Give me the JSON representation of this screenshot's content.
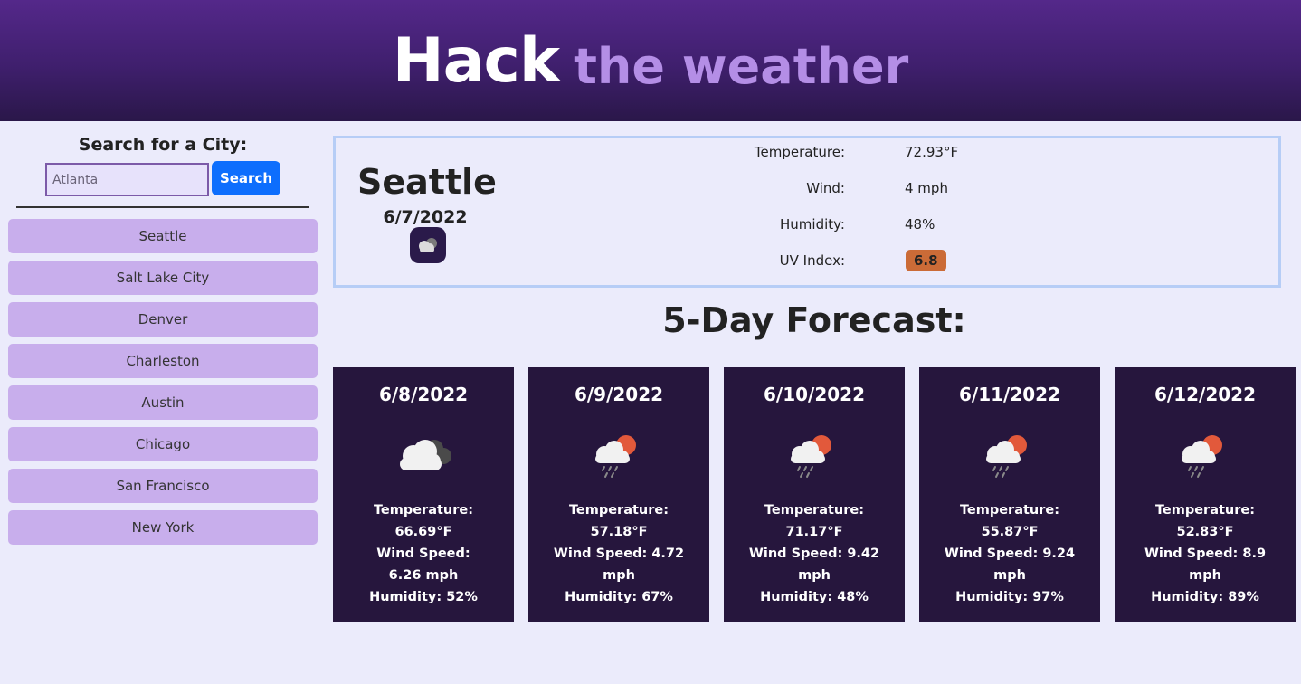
{
  "header": {
    "title_main": "Hack",
    "title_sub": "the weather"
  },
  "sidebar": {
    "search_label": "Search for a City:",
    "search_value": "Atlanta",
    "search_button": "Search",
    "cities": [
      "Seattle",
      "Salt Lake City",
      "Denver",
      "Charleston",
      "Austin",
      "Chicago",
      "San Francisco",
      "New York"
    ]
  },
  "current": {
    "city": "Seattle",
    "date": "6/7/2022",
    "icon": "cloudy-icon",
    "temperature_label": "Temperature:",
    "temperature": "72.93°F",
    "wind_label": "Wind:",
    "wind": "4 mph",
    "humidity_label": "Humidity:",
    "humidity": "48%",
    "uv_label": "UV Index:",
    "uv": "6.8",
    "uv_color": "#cb6b37"
  },
  "forecast": {
    "title": "5-Day Forecast:",
    "days": [
      {
        "date": "6/8/2022",
        "icon": "broken-clouds-icon",
        "temp_label": "Temperature:",
        "temp": "66.69°F",
        "wind_label": "Wind Speed:",
        "wind": "6.26 mph",
        "humidity": "Humidity: 52%"
      },
      {
        "date": "6/9/2022",
        "icon": "rain-sun-icon",
        "temp_label": "Temperature:",
        "temp": "57.18°F",
        "wind_label": "Wind Speed: 4.72",
        "wind": "mph",
        "humidity": "Humidity: 67%"
      },
      {
        "date": "6/10/2022",
        "icon": "rain-sun-icon",
        "temp_label": "Temperature:",
        "temp": "71.17°F",
        "wind_label": "Wind Speed: 9.42",
        "wind": "mph",
        "humidity": "Humidity: 48%"
      },
      {
        "date": "6/11/2022",
        "icon": "rain-sun-icon",
        "temp_label": "Temperature:",
        "temp": "55.87°F",
        "wind_label": "Wind Speed: 9.24",
        "wind": "mph",
        "humidity": "Humidity: 97%"
      },
      {
        "date": "6/12/2022",
        "icon": "rain-sun-icon",
        "temp_label": "Temperature:",
        "temp": "52.83°F",
        "wind_label": "Wind Speed: 8.9",
        "wind": "mph",
        "humidity": "Humidity: 89%"
      }
    ]
  },
  "colors": {
    "header": "#54288a",
    "accent": "#b48ee6",
    "card": "#26163d",
    "city_button": "#c8aeec",
    "search_button": "#0d6efd"
  }
}
